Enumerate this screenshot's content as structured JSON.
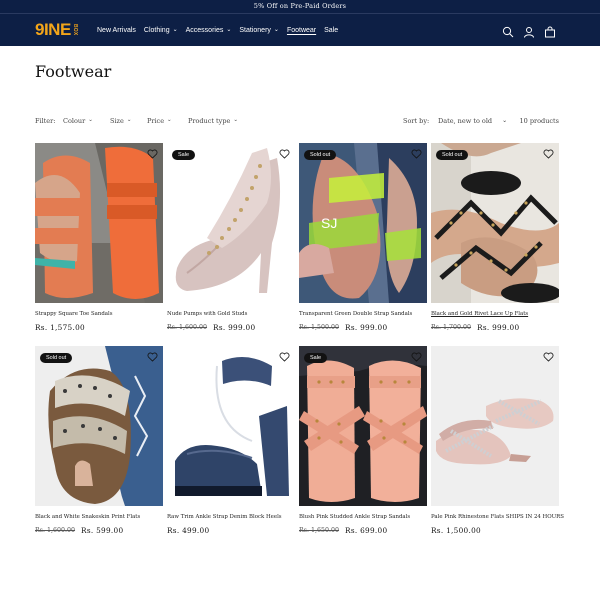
{
  "announcement": "5% Off on Pre-Paid Orders",
  "logo": {
    "main": "9INE",
    "sub": "BOX"
  },
  "nav": [
    {
      "label": "New Arrivals",
      "dropdown": false
    },
    {
      "label": "Clothing",
      "dropdown": true
    },
    {
      "label": "Accessories",
      "dropdown": true
    },
    {
      "label": "Stationery",
      "dropdown": true
    },
    {
      "label": "Footwear",
      "dropdown": false,
      "active": true
    },
    {
      "label": "Sale",
      "dropdown": false
    }
  ],
  "header_icons": [
    "search-icon",
    "account-icon",
    "cart-icon"
  ],
  "page_title": "Footwear",
  "filters": {
    "label": "Filter:",
    "options": [
      "Colour",
      "Size",
      "Price",
      "Product type"
    ],
    "sort_label": "Sort by:",
    "sort_value": "Date, new to old",
    "count": "10 products"
  },
  "products": [
    {
      "title": "Strappy Square Toe Sandals",
      "badge": "",
      "old_price": "",
      "price": "Rs. 1,575.00"
    },
    {
      "title": "Nude Pumps with Gold Studs",
      "badge": "Sale",
      "old_price": "Rs. 1,600.00",
      "price": "Rs. 999.00"
    },
    {
      "title": "Transparent Green Double Strap Sandals",
      "badge": "Sold out",
      "old_price": "Rs. 1,500.00",
      "price": "Rs. 999.00",
      "image_text": "SJ"
    },
    {
      "title": "Black and Gold Rivet Lace Up Flats",
      "badge": "Sold out",
      "old_price": "Rs. 1,700.00",
      "price": "Rs. 999.00"
    },
    {
      "title": "Black and White Snakeskin Print Flats",
      "badge": "Sold out",
      "old_price": "Rs. 1,600.00",
      "price": "Rs. 599.00"
    },
    {
      "title": "Raw Trim Ankle Strap Denim Block Heels",
      "badge": "",
      "old_price": "",
      "price": "Rs. 499.00"
    },
    {
      "title": "Blush Pink Studded Ankle Strap Sandals",
      "badge": "Sale",
      "old_price": "Rs. 1,650.00",
      "price": "Rs. 699.00"
    },
    {
      "title": "Pale Pink Rhinestone Flats SHIPS IN 24 HOURS",
      "badge": "",
      "old_price": "",
      "price": "Rs. 1,500.00"
    }
  ],
  "colors": {
    "header_bg": "#0d1f45",
    "logo": "#f2a51a",
    "badge_bg": "#121212"
  }
}
